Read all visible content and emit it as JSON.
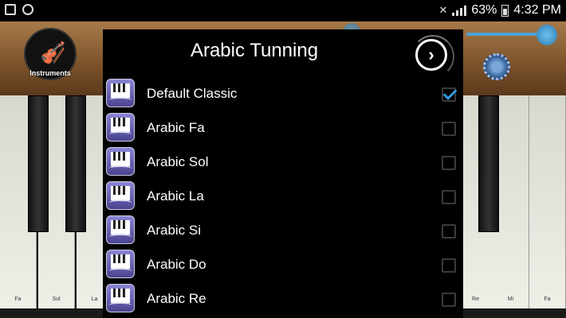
{
  "status_bar": {
    "battery": "63%",
    "time": "4:32 PM",
    "left_icons": [
      "gallery-icon",
      "sync-icon"
    ],
    "right_icons": [
      "mute-icon",
      "signal-icon",
      "battery-icon"
    ]
  },
  "background_app": {
    "instruments_label": "Instruments",
    "key_labels_left": [
      "Fa",
      "Sol",
      "La"
    ],
    "key_labels_right": [
      "Re",
      "Mi",
      "Fa"
    ]
  },
  "dialog": {
    "title": "Arabic Tunning",
    "next_icon": "chevron-right-icon",
    "items": [
      {
        "label": "Default Classic",
        "checked": true
      },
      {
        "label": "Arabic Fa",
        "checked": false
      },
      {
        "label": "Arabic Sol",
        "checked": false
      },
      {
        "label": "Arabic La",
        "checked": false
      },
      {
        "label": "Arabic Si",
        "checked": false
      },
      {
        "label": "Arabic Do",
        "checked": false
      },
      {
        "label": "Arabic Re",
        "checked": false
      }
    ]
  },
  "colors": {
    "accent": "#2e9bdc",
    "dialog_bg": "#000000",
    "header_wood": "#7b5129"
  }
}
